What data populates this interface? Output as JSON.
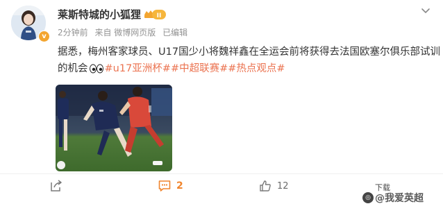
{
  "post": {
    "username": "莱斯特城的小狐狸",
    "level_badge": "II",
    "verified_mark": "v",
    "meta": {
      "time": "2分钟前",
      "source": "来自 微博网页版",
      "edited": "已编辑"
    },
    "text_prefix": "据悉，梅州客家球员、U17国少小将魏祥鑫在全运会前将获得去法国欧塞尔俱乐部试训的机会",
    "emoji_icon": "eyes-emoji",
    "topics": [
      "#u17亚洲杯#",
      "#中超联赛#",
      "#热点观点#"
    ],
    "image_alt_icon": "football-match-photo"
  },
  "actions": {
    "share_count": "",
    "comment_count": "2",
    "like_count": "12"
  },
  "overlay": {
    "download_label": "下载",
    "watermark": "@我爱英超",
    "watermark_logo": "头条"
  },
  "colors": {
    "topic": "#eb7350",
    "comment_active": "#f0842c",
    "meta_gray": "#939393",
    "level_badge": "#f3a530"
  }
}
